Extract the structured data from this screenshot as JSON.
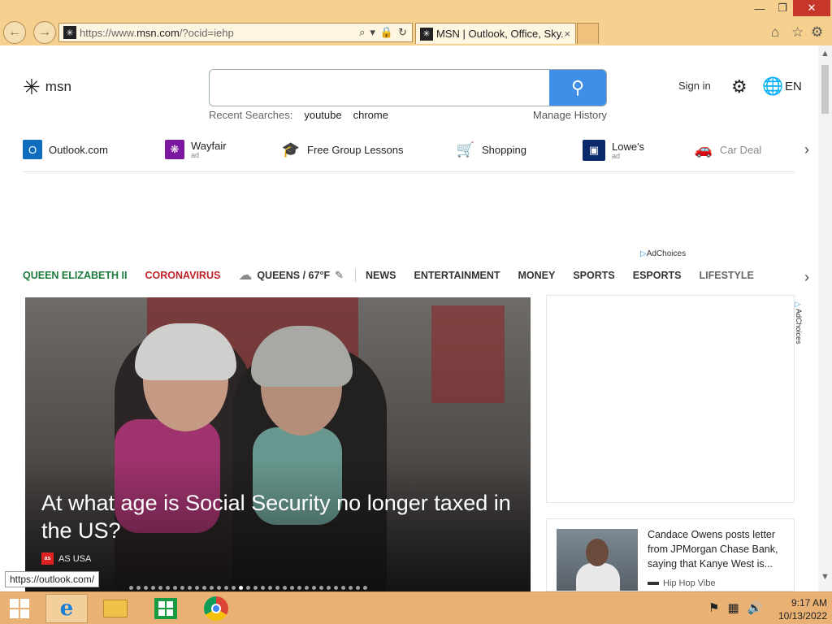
{
  "browser": {
    "url_prefix": "https://www.",
    "url_domain": "msn.com",
    "url_suffix": "/?ocid=iehp",
    "tab_title": "MSN | Outlook, Office, Sky...",
    "tab_close": "×",
    "favicon_glyph": "✳",
    "nav_back_glyph": "←",
    "nav_forward_glyph": "→",
    "url_tools": [
      "⌕",
      "▾",
      "🔒",
      "↻"
    ],
    "window_controls": {
      "minimize": "—",
      "restore": "❐",
      "close": "✕"
    },
    "icons": {
      "home": "⌂",
      "favorites": "☆",
      "settings": "⚙"
    }
  },
  "header": {
    "logo_mark": "✳",
    "logo_text": "msn",
    "search_value": "",
    "search_icon": "⚲",
    "recent_label": "Recent Searches:",
    "recent_searches": [
      "youtube",
      "chrome"
    ],
    "manage_history": "Manage History",
    "sign_in": "Sign in",
    "settings_icon": "⚙",
    "globe_icon": "🌐",
    "language": "EN"
  },
  "quick_links": [
    {
      "label": "Outlook.com",
      "sub": "",
      "icon": "outlook-icon",
      "glyph": "O",
      "color": "#0f6cbd"
    },
    {
      "label": "Wayfair",
      "sub": "ad",
      "icon": "wayfair-icon",
      "glyph": "❋",
      "color": "#7b189f"
    },
    {
      "label": "Free Group Lessons",
      "sub": "",
      "icon": "graduation-cap-icon",
      "glyph": "🎓",
      "color": "#5a2d91"
    },
    {
      "label": "Shopping",
      "sub": "",
      "icon": "shopping-cart-icon",
      "glyph": "🛒",
      "color": "#1e6fd9"
    },
    {
      "label": "Lowe's",
      "sub": "ad",
      "icon": "lowes-icon",
      "glyph": "▣",
      "color": "#0b2a6b"
    },
    {
      "label": "Car Deal",
      "sub": "",
      "icon": "car-icon",
      "glyph": "🚗",
      "color": "#3a7fd5"
    }
  ],
  "quick_links_next": "›",
  "ad_choices": "AdChoices",
  "ad_choices_glyph": "▷",
  "nav": {
    "queen": "QUEEN ELIZABETH II",
    "corona": "CORONAVIRUS",
    "weather_glyph": "☁",
    "weather": "QUEENS / 67°F",
    "edit_glyph": "✎",
    "items": [
      "NEWS",
      "ENTERTAINMENT",
      "MONEY",
      "SPORTS",
      "ESPORTS",
      "LIFESTYLE"
    ],
    "next": "›"
  },
  "hero": {
    "title": "At what age is Social Security no longer taxed in the US?",
    "source": "AS USA",
    "source_logo": "as",
    "dots_total": 33,
    "dots_active": 15
  },
  "ad_vertical": "AdChoices",
  "card": {
    "title": "Candace Owens posts letter from JPMorgan Chase Bank, saying that Kanye West is...",
    "source": "Hip Hop Vibe"
  },
  "status_url": "https://outlook.com/",
  "taskbar": {
    "ie_glyph": "e",
    "tray": [
      "⚑",
      "▦",
      "🔊"
    ],
    "time": "9:17 AM",
    "date": "10/13/2022"
  },
  "scrollbar": {
    "up": "▲",
    "down": "▼"
  }
}
